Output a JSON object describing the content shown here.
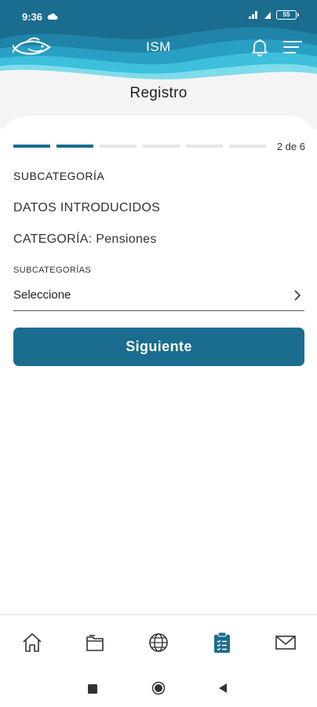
{
  "statusbar": {
    "time": "9:36",
    "battery": "55"
  },
  "header": {
    "title": "ISM"
  },
  "page": {
    "title": "Registro"
  },
  "steps": {
    "total": 6,
    "current": 2,
    "counter": "2 de 6"
  },
  "form": {
    "section_heading": "SUBCATEGORÍA",
    "info_heading": "DATOS INTRODUCIDOS",
    "category_line": "CATEGORÍA: Pensiones",
    "subcategory_label": "SUBCATEGORÍAS",
    "subcategory_value": "Seleccione",
    "next_label": "Siguiente"
  },
  "bottom_nav": {
    "items": [
      {
        "name": "home",
        "icon": "home-icon",
        "active": false
      },
      {
        "name": "documents",
        "icon": "folder-icon",
        "active": false
      },
      {
        "name": "web",
        "icon": "globe-icon",
        "active": false
      },
      {
        "name": "registry",
        "icon": "clipboard-icon",
        "active": true
      },
      {
        "name": "messages",
        "icon": "mail-icon",
        "active": false
      }
    ]
  },
  "colors": {
    "brand": "#1a6d8f",
    "accent": "#2bb3d3",
    "inactive_icon": "#333333"
  }
}
